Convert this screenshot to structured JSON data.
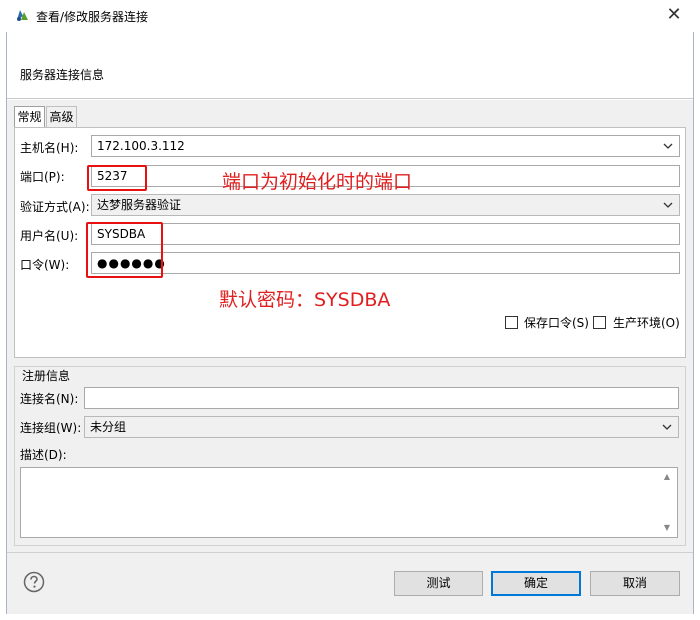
{
  "window": {
    "title": "查看/修改服务器连接",
    "header": "服务器连接信息"
  },
  "tabs": [
    {
      "label": "常规",
      "active": true
    },
    {
      "label": "高级",
      "active": false
    }
  ],
  "general": {
    "host_label": "主机名(H):",
    "host_value": "172.100.3.112",
    "port_label": "端口(P):",
    "port_value": "5237",
    "auth_label": "验证方式(A):",
    "auth_value": "达梦服务器验证",
    "user_label": "用户名(U):",
    "user_value": "SYSDBA",
    "password_label": "口令(W):",
    "password_value": "●●●●●●",
    "save_password_label": "保存口令(S)",
    "save_password_checked": false,
    "production_label": "生产环境(O)",
    "production_checked": false
  },
  "annotations": {
    "port_note": "端口为初始化时的端口",
    "password_note": "默认密码：SYSDBA"
  },
  "registration": {
    "title": "注册信息",
    "conn_name_label": "连接名(N):",
    "conn_name_value": "",
    "conn_group_label": "连接组(W):",
    "conn_group_value": "未分组",
    "desc_label": "描述(D):",
    "desc_value": ""
  },
  "buttons": {
    "test": "测试",
    "ok": "确定",
    "cancel": "取消"
  },
  "colors": {
    "annotation_red": "#e02020",
    "default_button_border": "#0078d7"
  }
}
